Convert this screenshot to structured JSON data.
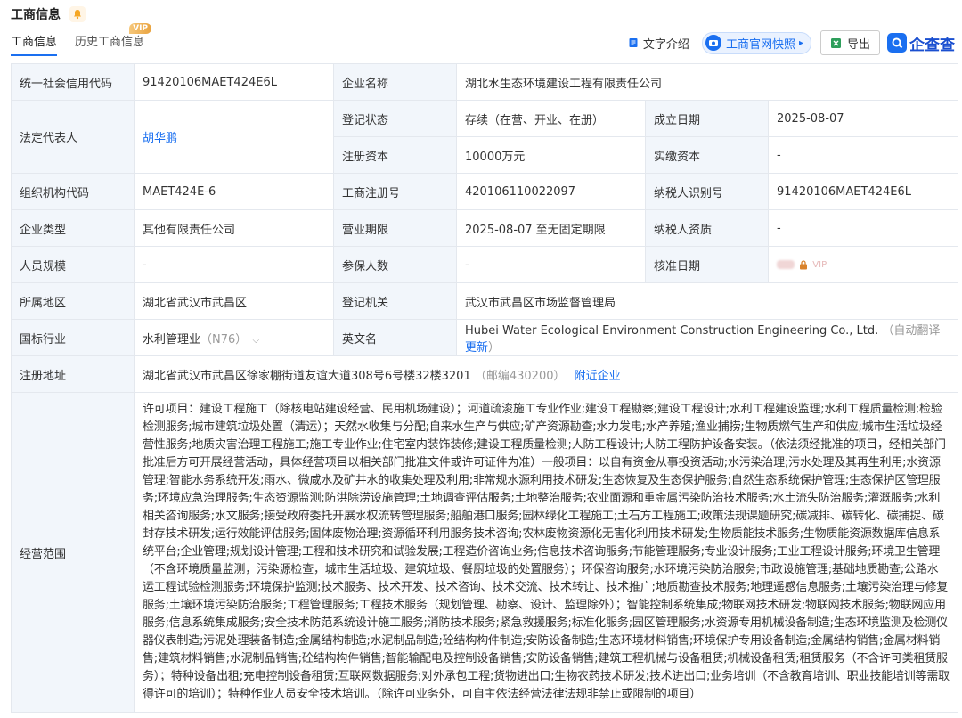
{
  "header": {
    "title": "工商信息"
  },
  "tabs": [
    {
      "label": "工商信息"
    },
    {
      "label": "历史工商信息",
      "badge": "VIP"
    }
  ],
  "toolbar": {
    "text_intro": "文字介绍",
    "snapshot": "工商官网快照",
    "export": "导出",
    "logo": "企查查"
  },
  "rows": {
    "credit_code_label": "统一社会信用代码",
    "credit_code": "91420106MAET424E6L",
    "company_name_label": "企业名称",
    "company_name": "湖北水生态环境建设工程有限责任公司",
    "legal_rep_label": "法定代表人",
    "legal_rep": "胡华鹏",
    "reg_status_label": "登记状态",
    "reg_status": "存续（在营、开业、在册）",
    "found_date_label": "成立日期",
    "found_date": "2025-08-07",
    "reg_capital_label": "注册资本",
    "reg_capital": "10000万元",
    "paid_capital_label": "实缴资本",
    "paid_capital": "-",
    "org_code_label": "组织机构代码",
    "org_code": "MAET424E-6",
    "biz_reg_no_label": "工商注册号",
    "biz_reg_no": "420106110022097",
    "taxpayer_id_label": "纳税人识别号",
    "taxpayer_id": "91420106MAET424E6L",
    "company_type_label": "企业类型",
    "company_type": "其他有限责任公司",
    "term_label": "营业期限",
    "term": "2025-08-07 至无固定期限",
    "taxpayer_qual_label": "纳税人资质",
    "taxpayer_qual": "-",
    "staff_size_label": "人员规模",
    "staff_size": "-",
    "insured_label": "参保人数",
    "insured": "-",
    "approval_date_label": "核准日期",
    "approval_vip": "VIP",
    "region_label": "所属地区",
    "region": "湖北省武汉市武昌区",
    "reg_authority_label": "登记机关",
    "reg_authority": "武汉市武昌区市场监督管理局",
    "industry_label": "国标行业",
    "industry": "水利管理业",
    "industry_code": "（N76）",
    "english_name_label": "英文名",
    "english_name": "Hubei Water Ecological Environment Construction Engineering Co., Ltd.",
    "auto_translate": "（自动翻译",
    "update": "更新",
    "close_paren": "）",
    "address_label": "注册地址",
    "address": "湖北省武汉市武昌区徐家棚街道友谊大道308号6号楼32楼3201",
    "postcode": "（邮编430200）",
    "nearby": "附近企业",
    "scope_label": "经营范围",
    "scope": "许可项目：建设工程施工（除核电站建设经营、民用机场建设）；河道疏浚施工专业作业;建设工程勘察;建设工程设计;水利工程建设监理;水利工程质量检测;检验检测服务;城市建筑垃圾处置（清运）；天然水收集与分配;自来水生产与供应;矿产资源勘查;水力发电;水产养殖;渔业捕捞;生物质燃气生产和供应;城市生活垃圾经营性服务;地质灾害治理工程施工;施工专业作业;住宅室内装饰装修;建设工程质量检测;人防工程设计;人防工程防护设备安装。（依法须经批准的项目，经相关部门批准后方可开展经营活动，具体经营项目以相关部门批准文件或许可证件为准）一般项目：以自有资金从事投资活动;水污染治理;污水处理及其再生利用;水资源管理;智能水务系统开发;雨水、微咸水及矿井水的收集处理及利用;非常规水源利用技术研发;生态恢复及生态保护服务;自然生态系统保护管理;生态保护区管理服务;环境应急治理服务;生态资源监测;防洪除涝设施管理;土地调查评估服务;土地整治服务;农业面源和重金属污染防治技术服务;水土流失防治服务;灌溉服务;水利相关咨询服务;水文服务;接受政府委托开展水权流转管理服务;船舶港口服务;园林绿化工程施工;土石方工程施工;政策法规课题研究;碳减排、碳转化、碳捕捉、碳封存技术研发;运行效能评估服务;固体废物治理;资源循环利用服务技术咨询;农林废物资源化无害化利用技术研发;生物质能技术服务;生物质能资源数据库信息系统平台;企业管理;规划设计管理;工程和技术研究和试验发展;工程造价咨询业务;信息技术咨询服务;节能管理服务;专业设计服务;工业工程设计服务;环境卫生管理（不含环境质量监测，污染源检查，城市生活垃圾、建筑垃圾、餐厨垃圾的处置服务）；环保咨询服务;水环境污染防治服务;市政设施管理;基础地质勘查;公路水运工程试验检测服务;环境保护监测;技术服务、技术开发、技术咨询、技术交流、技术转让、技术推广;地质勘查技术服务;地理遥感信息服务;土壤污染治理与修复服务;土壤环境污染防治服务;工程管理服务;工程技术服务（规划管理、勘察、设计、监理除外）；智能控制系统集成;物联网技术研发;物联网技术服务;物联网应用服务;信息系统集成服务;安全技术防范系统设计施工服务;消防技术服务;紧急救援服务;标准化服务;园区管理服务;水资源专用机械设备制造;生态环境监测及检测仪器仪表制造;污泥处理装备制造;金属结构制造;水泥制品制造;砼结构构件制造;安防设备制造;生态环境材料销售;环境保护专用设备制造;金属结构销售;金属材料销售;建筑材料销售;水泥制品销售;砼结构构件销售;智能输配电及控制设备销售;安防设备销售;建筑工程机械与设备租赁;机械设备租赁;租赁服务（不含许可类租赁服务）；特种设备出租;充电控制设备租赁;互联网数据服务;对外承包工程;货物进出口;生物农药技术研发;技术进出口;业务培训（不含教育培训、职业技能培训等需取得许可的培训）；特种作业人员安全技术培训。（除许可业务外，可自主依法经营法律法规非禁止或限制的项目）"
  },
  "colors": {
    "accent": "#1a6ff0",
    "label_bg": "#f2f6fb",
    "border": "#e4e8ee"
  }
}
